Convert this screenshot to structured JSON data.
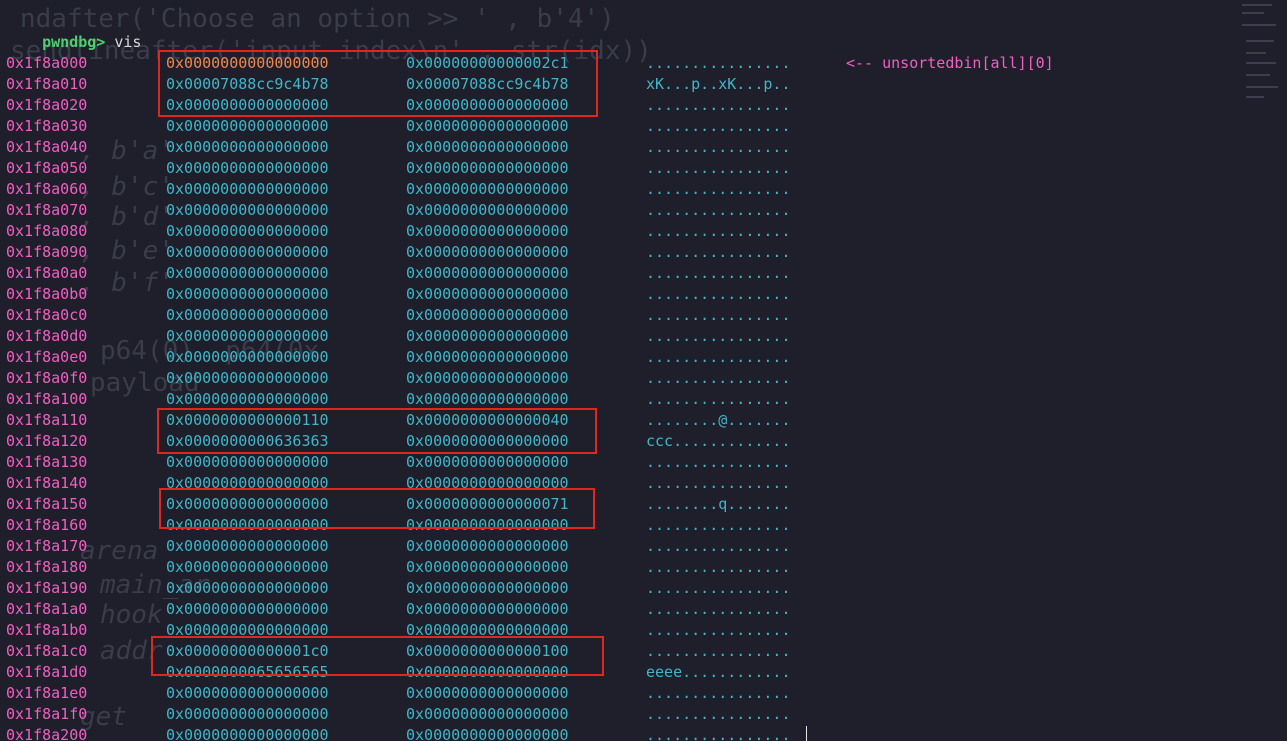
{
  "terminal": {
    "prompt": "pwndbg>",
    "command": " vis",
    "background": "#1e1f2b",
    "colors": {
      "address": "#f25fc2",
      "value": "#3fb7c9",
      "highlight_value": "#f0884e",
      "prompt": "#4fd06e",
      "box": "#e0271f"
    }
  },
  "rows": [
    {
      "addr": "0x1f8a000",
      "q1": "0x0000000000000000",
      "q2": "0x00000000000002c1",
      "ascii": "................",
      "note": "<-- unsortedbin[all][0]"
    },
    {
      "addr": "0x1f8a010",
      "q1": "0x00007088cc9c4b78",
      "q2": "0x00007088cc9c4b78",
      "ascii": "xK...p..xK...p.."
    },
    {
      "addr": "0x1f8a020",
      "q1": "0x0000000000000000",
      "q2": "0x0000000000000000",
      "ascii": "................"
    },
    {
      "addr": "0x1f8a030",
      "q1": "0x0000000000000000",
      "q2": "0x0000000000000000",
      "ascii": "................"
    },
    {
      "addr": "0x1f8a040",
      "q1": "0x0000000000000000",
      "q2": "0x0000000000000000",
      "ascii": "................"
    },
    {
      "addr": "0x1f8a050",
      "q1": "0x0000000000000000",
      "q2": "0x0000000000000000",
      "ascii": "................"
    },
    {
      "addr": "0x1f8a060",
      "q1": "0x0000000000000000",
      "q2": "0x0000000000000000",
      "ascii": "................"
    },
    {
      "addr": "0x1f8a070",
      "q1": "0x0000000000000000",
      "q2": "0x0000000000000000",
      "ascii": "................"
    },
    {
      "addr": "0x1f8a080",
      "q1": "0x0000000000000000",
      "q2": "0x0000000000000000",
      "ascii": "................"
    },
    {
      "addr": "0x1f8a090",
      "q1": "0x0000000000000000",
      "q2": "0x0000000000000000",
      "ascii": "................"
    },
    {
      "addr": "0x1f8a0a0",
      "q1": "0x0000000000000000",
      "q2": "0x0000000000000000",
      "ascii": "................"
    },
    {
      "addr": "0x1f8a0b0",
      "q1": "0x0000000000000000",
      "q2": "0x0000000000000000",
      "ascii": "................"
    },
    {
      "addr": "0x1f8a0c0",
      "q1": "0x0000000000000000",
      "q2": "0x0000000000000000",
      "ascii": "................"
    },
    {
      "addr": "0x1f8a0d0",
      "q1": "0x0000000000000000",
      "q2": "0x0000000000000000",
      "ascii": "................"
    },
    {
      "addr": "0x1f8a0e0",
      "q1": "0x0000000000000000",
      "q2": "0x0000000000000000",
      "ascii": "................"
    },
    {
      "addr": "0x1f8a0f0",
      "q1": "0x0000000000000000",
      "q2": "0x0000000000000000",
      "ascii": "................"
    },
    {
      "addr": "0x1f8a100",
      "q1": "0x0000000000000000",
      "q2": "0x0000000000000000",
      "ascii": "................"
    },
    {
      "addr": "0x1f8a110",
      "q1": "0x0000000000000110",
      "q2": "0x0000000000000040",
      "ascii": "........@......."
    },
    {
      "addr": "0x1f8a120",
      "q1": "0x0000000000636363",
      "q2": "0x0000000000000000",
      "ascii": "ccc............."
    },
    {
      "addr": "0x1f8a130",
      "q1": "0x0000000000000000",
      "q2": "0x0000000000000000",
      "ascii": "................"
    },
    {
      "addr": "0x1f8a140",
      "q1": "0x0000000000000000",
      "q2": "0x0000000000000000",
      "ascii": "................"
    },
    {
      "addr": "0x1f8a150",
      "q1": "0x0000000000000000",
      "q2": "0x0000000000000071",
      "ascii": "........q......."
    },
    {
      "addr": "0x1f8a160",
      "q1": "0x0000000000000000",
      "q2": "0x0000000000000000",
      "ascii": "................"
    },
    {
      "addr": "0x1f8a170",
      "q1": "0x0000000000000000",
      "q2": "0x0000000000000000",
      "ascii": "................"
    },
    {
      "addr": "0x1f8a180",
      "q1": "0x0000000000000000",
      "q2": "0x0000000000000000",
      "ascii": "................"
    },
    {
      "addr": "0x1f8a190",
      "q1": "0x0000000000000000",
      "q2": "0x0000000000000000",
      "ascii": "................"
    },
    {
      "addr": "0x1f8a1a0",
      "q1": "0x0000000000000000",
      "q2": "0x0000000000000000",
      "ascii": "................"
    },
    {
      "addr": "0x1f8a1b0",
      "q1": "0x0000000000000000",
      "q2": "0x0000000000000000",
      "ascii": "................"
    },
    {
      "addr": "0x1f8a1c0",
      "q1": "0x00000000000001c0",
      "q2": "0x0000000000000100",
      "ascii": "................"
    },
    {
      "addr": "0x1f8a1d0",
      "q1": "0x0000000065656565",
      "q2": "0x0000000000000000",
      "ascii": "eeee............"
    },
    {
      "addr": "0x1f8a1e0",
      "q1": "0x0000000000000000",
      "q2": "0x0000000000000000",
      "ascii": "................"
    },
    {
      "addr": "0x1f8a1f0",
      "q1": "0x0000000000000000",
      "q2": "0x0000000000000000",
      "ascii": "................"
    },
    {
      "addr": "0x1f8a200",
      "q1": "0x0000000000000000",
      "q2": "0x0000000000000000",
      "ascii": "................"
    }
  ],
  "background_code": [
    "ndafter('Choose an option >> ' , b'4')",
    "sendlineafter('input index\\n' , str(idx))",
    ", b'a'",
    ", b'c'",
    ", b'd'",
    ", b'e'",
    ", b'f'",
    "p64(0)  p64(0x",
    "payload",
    "arena",
    "main_ar",
    "hook",
    "addr",
    "get"
  ]
}
